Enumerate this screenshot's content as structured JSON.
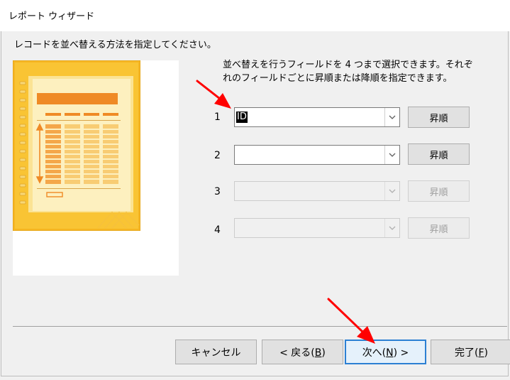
{
  "window": {
    "title": "レポート ウィザード"
  },
  "instruction": "レコードを並べ替える方法を指定してください。",
  "description": {
    "line1": "並べ替えを行うフィールドを 4 つまで選択できます。それぞ",
    "line2": "れのフィールドごとに昇順または降順を指定できます。"
  },
  "sort_rows": [
    {
      "number": "1",
      "value": "ID",
      "order": "昇順",
      "enabled": true
    },
    {
      "number": "2",
      "value": "",
      "order": "昇順",
      "enabled": true
    },
    {
      "number": "3",
      "value": "",
      "order": "昇順",
      "enabled": false
    },
    {
      "number": "4",
      "value": "",
      "order": "昇順",
      "enabled": false
    }
  ],
  "footer": {
    "cancel": "キャンセル",
    "back": {
      "prefix": "< 戻る(",
      "key": "B",
      "suffix": ")"
    },
    "next": {
      "prefix": "次へ(",
      "key": "N",
      "suffix": ") >"
    },
    "finish": {
      "prefix": "完了(",
      "key": "F",
      "suffix": ")"
    }
  },
  "colors": {
    "accent": "#2c80d3",
    "annotation_arrow": "#ff0000",
    "preview_gold": "#f6b623",
    "preview_orange": "#ef8a25"
  }
}
